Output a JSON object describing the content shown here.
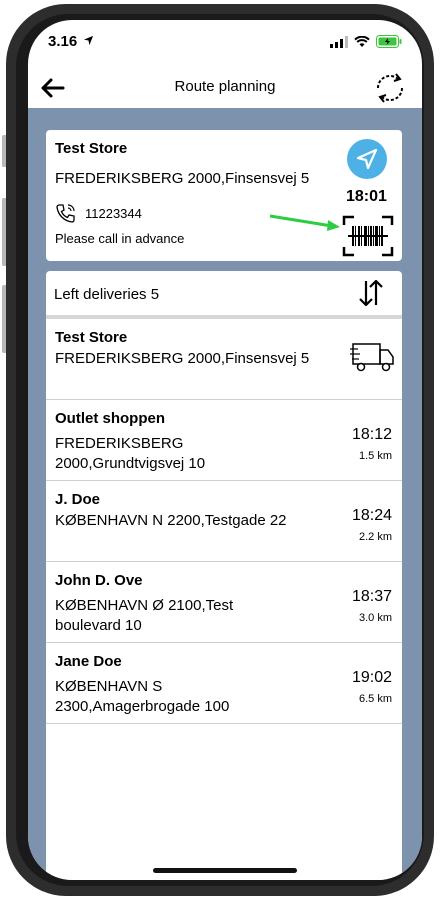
{
  "status": {
    "time": "3.16"
  },
  "header": {
    "title": "Route planning"
  },
  "current": {
    "name": "Test Store",
    "address": "FREDERIKSBERG 2000,Finsensvej 5",
    "phone": "11223344",
    "note": "Please call in advance",
    "eta": "18:01"
  },
  "list": {
    "header_label": "Left deliveries 5",
    "rows": [
      {
        "name": "Test Store",
        "address": "FREDERIKSBERG 2000,Finsensvej 5"
      },
      {
        "name": "Outlet shoppen",
        "address": "FREDERIKSBERG 2000,Grundtvigsvej 10",
        "time": "18:12",
        "distance": "1.5 km"
      },
      {
        "name": "J. Doe",
        "address": "KØBENHAVN N 2200,Testgade 22",
        "time": "18:24",
        "distance": "2.2 km"
      },
      {
        "name": "John D. Ove",
        "address": "KØBENHAVN Ø 2100,Test boulevard 10",
        "time": "18:37",
        "distance": "3.0 km"
      },
      {
        "name": "Jane Doe",
        "address": "KØBENHAVN S 2300,Amagerbrogade 100",
        "time": "19:02",
        "distance": "6.5 km"
      }
    ]
  },
  "colors": {
    "background": "#7d92ad",
    "nav_button": "#4db1e6",
    "annotation_arrow": "#2ecc40",
    "battery": "#3ec43e"
  },
  "icons": [
    "back-arrow-icon",
    "refresh-icon",
    "navigation-icon",
    "phone-icon",
    "barcode-scanner-icon",
    "sort-icon",
    "truck-icon"
  ]
}
